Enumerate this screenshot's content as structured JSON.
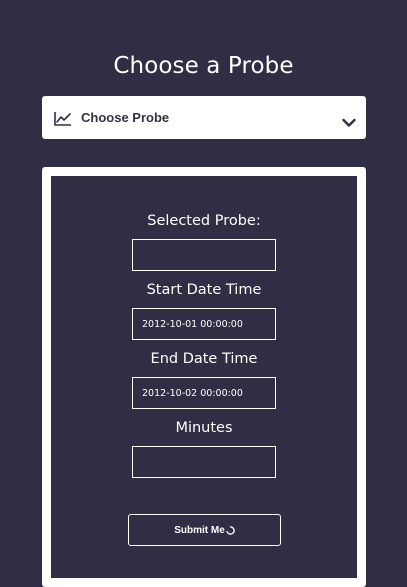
{
  "page": {
    "title": "Choose a Probe"
  },
  "probe_select": {
    "label": "Choose Probe",
    "icon": "line-chart-icon",
    "chevron": "chevron-down-icon"
  },
  "form": {
    "selected_probe": {
      "label": "Selected Probe:",
      "value": ""
    },
    "start_date_time": {
      "label": "Start Date Time",
      "value": "2012-10-01 00:00:00"
    },
    "end_date_time": {
      "label": "End Date Time",
      "value": "2012-10-02 00:00:00"
    },
    "minutes": {
      "label": "Minutes",
      "value": ""
    },
    "submit": {
      "label": "Submit Me",
      "icon": "loading-spinner-icon"
    }
  },
  "colors": {
    "background": "#2f2e44",
    "panel": "#ffffff",
    "text_light": "#ffffff",
    "text_dark": "#333344"
  }
}
